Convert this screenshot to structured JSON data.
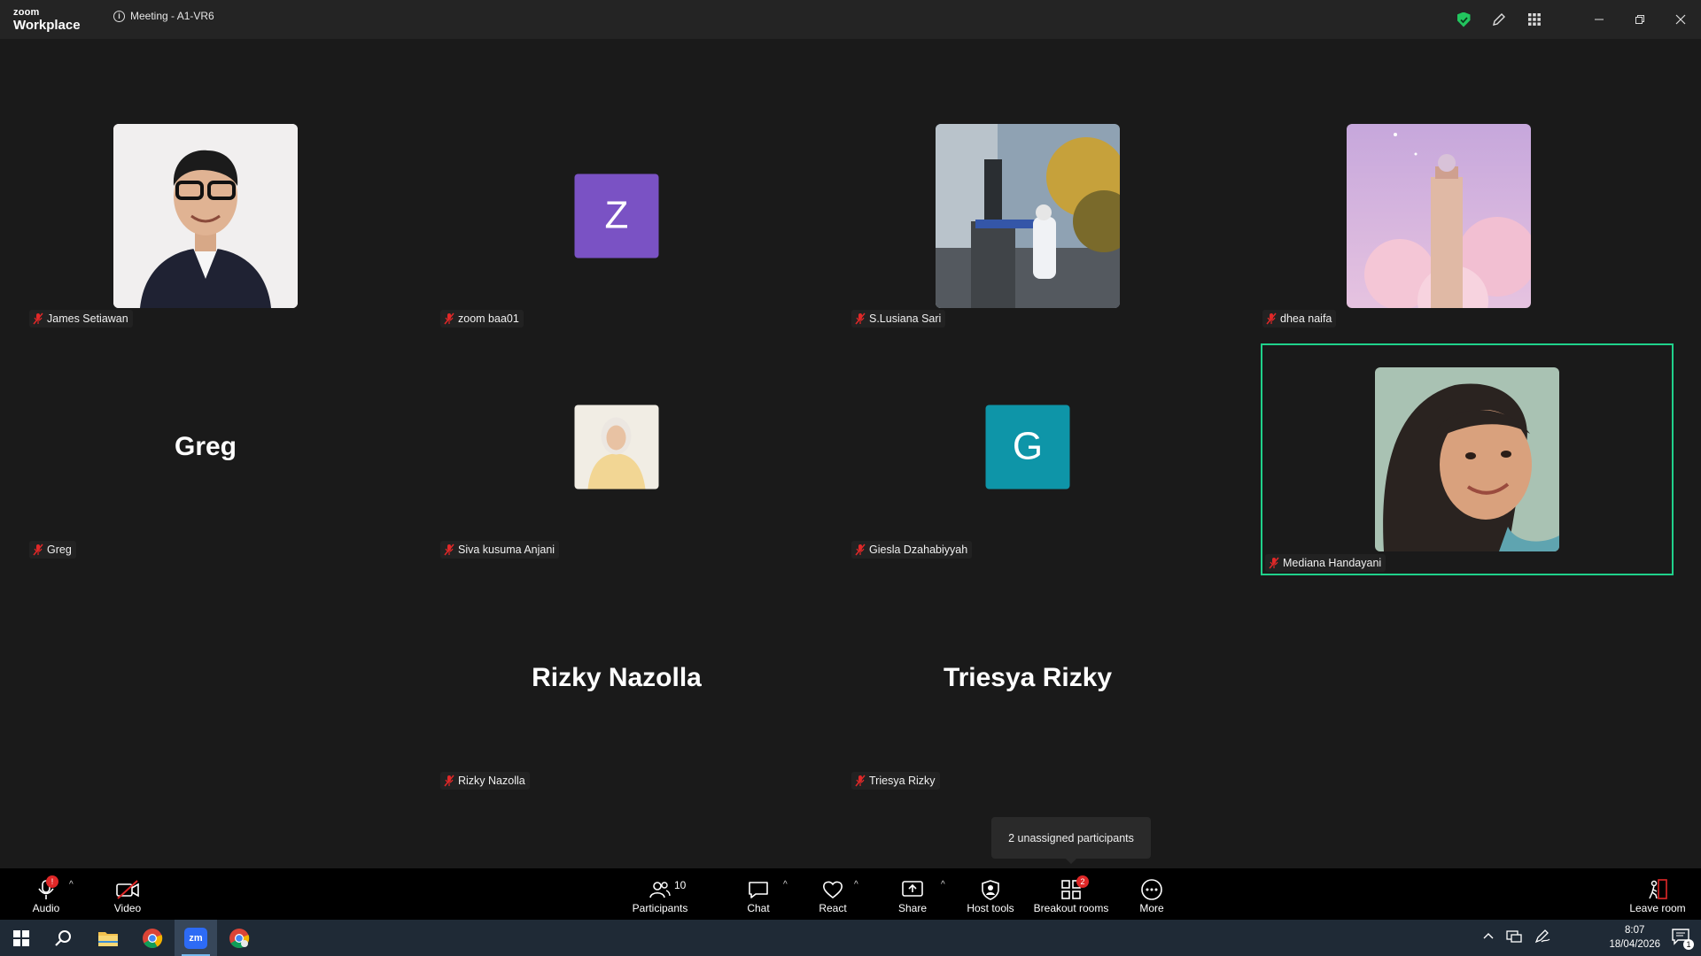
{
  "titlebar": {
    "logo_line1": "zoom",
    "logo_line2": "Workplace",
    "meeting_title": "Meeting - A1-VR6",
    "colors": {
      "shield": "#22c55e"
    }
  },
  "participants": [
    {
      "name": "James Setiawan",
      "display": "photo",
      "muted": true
    },
    {
      "name": "zoom baa01",
      "display": "initial",
      "initial": "Z",
      "color": "#7a52c4",
      "muted": true
    },
    {
      "name": "S.Lusiana Sari",
      "display": "photo",
      "muted": true
    },
    {
      "name": "dhea naifa",
      "display": "photo",
      "muted": true
    },
    {
      "name": "Greg",
      "display": "name",
      "big_name": "Greg",
      "muted": true
    },
    {
      "name": "Siva kusuma Anjani",
      "display": "small-photo",
      "muted": true
    },
    {
      "name": "Giesla Dzahabiyyah",
      "display": "initial",
      "initial": "G",
      "color": "#0e95a8",
      "muted": true
    },
    {
      "name": "Mediana Handayani",
      "display": "photo",
      "muted": true,
      "active_speaker": true
    },
    {
      "name": "Rizky Nazolla",
      "display": "name",
      "big_name": "Rizky Nazolla",
      "muted": true
    },
    {
      "name": "Triesya Rizky",
      "display": "name",
      "big_name": "Triesya Rizky",
      "muted": true
    }
  ],
  "tooltip": "2 unassigned participants",
  "toolbar": {
    "audio": "Audio",
    "audio_badge": "!",
    "video": "Video",
    "participants": "Participants",
    "participants_count": "10",
    "chat": "Chat",
    "react": "React",
    "share": "Share",
    "host_tools": "Host tools",
    "breakout_rooms": "Breakout rooms",
    "breakout_badge": "2",
    "more": "More",
    "leave": "Leave room"
  },
  "taskbar": {
    "time": "8:07",
    "date": "18/04/2026",
    "notification_count": "1"
  },
  "colors": {
    "active_border": "#1fd18b",
    "muted_icon": "#e02828"
  }
}
